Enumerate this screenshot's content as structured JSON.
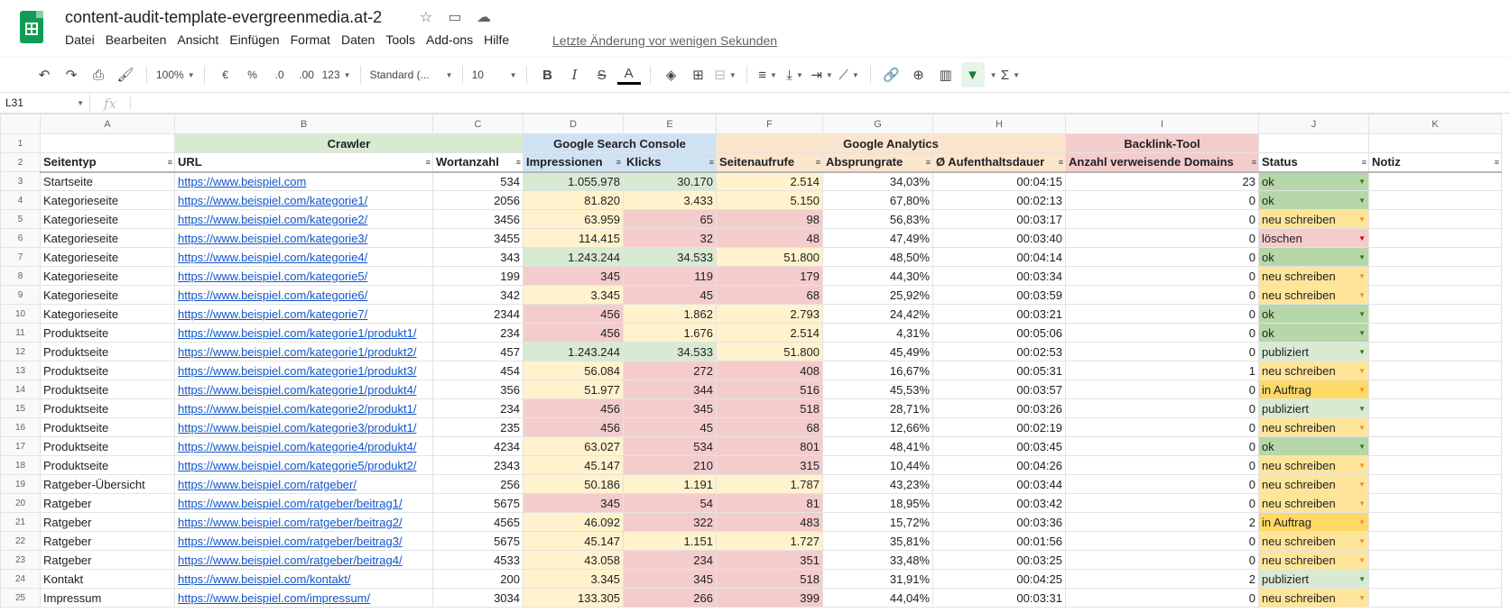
{
  "doc": {
    "title": "content-audit-template-evergreenmedia.at-2",
    "last_edit": "Letzte Änderung vor wenigen Sekunden"
  },
  "menu": [
    "Datei",
    "Bearbeiten",
    "Ansicht",
    "Einfügen",
    "Format",
    "Daten",
    "Tools",
    "Add-ons",
    "Hilfe"
  ],
  "toolbar": {
    "zoom": "100%",
    "currency": "€",
    "percent": "%",
    "dec_less": ".0",
    "dec_more": ".00",
    "more_formats": "123",
    "font": "Standard (...",
    "font_size": "10"
  },
  "formula": {
    "cell_ref": "L31",
    "fx": "fx"
  },
  "columns": [
    "A",
    "B",
    "C",
    "D",
    "E",
    "F",
    "G",
    "H",
    "I",
    "J",
    "K"
  ],
  "groups": {
    "crawler": "Crawler",
    "gsc": "Google Search Console",
    "ga": "Google Analytics",
    "backlink": "Backlink-Tool"
  },
  "headers": [
    "Seitentyp",
    "URL",
    "Wortanzahl",
    "Impressionen",
    "Klicks",
    "Seitenaufrufe",
    "Absprungrate",
    "Ø Aufenthaltsdauer",
    "Anzahl verweisende Domains",
    "Status",
    "Notiz"
  ],
  "colors": {
    "green": "#d9ead3",
    "yellow": "#fff2cc",
    "red": "#f4cccc",
    "link": "#1155cc",
    "brand": "#0f9d58"
  },
  "rows": [
    {
      "n": "3",
      "typ": "Startseite",
      "url": "https://www.beispiel.com",
      "wort": "534",
      "imp": "1.055.978",
      "klick": "30.170",
      "aufr": "2.514",
      "abs": "34,03%",
      "dauer": "00:04:15",
      "dom": "23",
      "status": "ok",
      "ci": "green",
      "ck": "green",
      "ca": "yellow"
    },
    {
      "n": "4",
      "typ": "Kategorieseite",
      "url": "https://www.beispiel.com/kategorie1/",
      "wort": "2056",
      "imp": "81.820",
      "klick": "3.433",
      "aufr": "5.150",
      "abs": "67,80%",
      "dauer": "00:02:13",
      "dom": "0",
      "status": "ok",
      "ci": "yellow",
      "ck": "yellow",
      "ca": "yellow"
    },
    {
      "n": "5",
      "typ": "Kategorieseite",
      "url": "https://www.beispiel.com/kategorie2/",
      "wort": "3456",
      "imp": "63.959",
      "klick": "65",
      "aufr": "98",
      "abs": "56,83%",
      "dauer": "00:03:17",
      "dom": "0",
      "status": "neu schreiben",
      "ci": "yellow",
      "ck": "red",
      "ca": "red"
    },
    {
      "n": "6",
      "typ": "Kategorieseite",
      "url": "https://www.beispiel.com/kategorie3/",
      "wort": "3455",
      "imp": "114.415",
      "klick": "32",
      "aufr": "48",
      "abs": "47,49%",
      "dauer": "00:03:40",
      "dom": "0",
      "status": "löschen",
      "ci": "yellow",
      "ck": "red",
      "ca": "red"
    },
    {
      "n": "7",
      "typ": "Kategorieseite",
      "url": "https://www.beispiel.com/kategorie4/",
      "wort": "343",
      "imp": "1.243.244",
      "klick": "34.533",
      "aufr": "51.800",
      "abs": "48,50%",
      "dauer": "00:04:14",
      "dom": "0",
      "status": "ok",
      "ci": "green",
      "ck": "green",
      "ca": "yellow"
    },
    {
      "n": "8",
      "typ": "Kategorieseite",
      "url": "https://www.beispiel.com/kategorie5/",
      "wort": "199",
      "imp": "345",
      "klick": "119",
      "aufr": "179",
      "abs": "44,30%",
      "dauer": "00:03:34",
      "dom": "0",
      "status": "neu schreiben",
      "ci": "red",
      "ck": "red",
      "ca": "red"
    },
    {
      "n": "9",
      "typ": "Kategorieseite",
      "url": "https://www.beispiel.com/kategorie6/",
      "wort": "342",
      "imp": "3.345",
      "klick": "45",
      "aufr": "68",
      "abs": "25,92%",
      "dauer": "00:03:59",
      "dom": "0",
      "status": "neu schreiben",
      "ci": "yellow",
      "ck": "red",
      "ca": "red"
    },
    {
      "n": "10",
      "typ": "Kategorieseite",
      "url": "https://www.beispiel.com/kategorie7/",
      "wort": "2344",
      "imp": "456",
      "klick": "1.862",
      "aufr": "2.793",
      "abs": "24,42%",
      "dauer": "00:03:21",
      "dom": "0",
      "status": "ok",
      "ci": "red",
      "ck": "yellow",
      "ca": "yellow"
    },
    {
      "n": "11",
      "typ": "Produktseite",
      "url": "https://www.beispiel.com/kategorie1/produkt1/",
      "wort": "234",
      "imp": "456",
      "klick": "1.676",
      "aufr": "2.514",
      "abs": "4,31%",
      "dauer": "00:05:06",
      "dom": "0",
      "status": "ok",
      "ci": "red",
      "ck": "yellow",
      "ca": "yellow"
    },
    {
      "n": "12",
      "typ": "Produktseite",
      "url": "https://www.beispiel.com/kategorie1/produkt2/",
      "wort": "457",
      "imp": "1.243.244",
      "klick": "34.533",
      "aufr": "51.800",
      "abs": "45,49%",
      "dauer": "00:02:53",
      "dom": "0",
      "status": "publiziert",
      "ci": "green",
      "ck": "green",
      "ca": "yellow"
    },
    {
      "n": "13",
      "typ": "Produktseite",
      "url": "https://www.beispiel.com/kategorie1/produkt3/",
      "wort": "454",
      "imp": "56.084",
      "klick": "272",
      "aufr": "408",
      "abs": "16,67%",
      "dauer": "00:05:31",
      "dom": "1",
      "status": "neu schreiben",
      "ci": "yellow",
      "ck": "red",
      "ca": "red"
    },
    {
      "n": "14",
      "typ": "Produktseite",
      "url": "https://www.beispiel.com/kategorie1/produkt4/",
      "wort": "356",
      "imp": "51.977",
      "klick": "344",
      "aufr": "516",
      "abs": "45,53%",
      "dauer": "00:03:57",
      "dom": "0",
      "status": "in Auftrag",
      "ci": "yellow",
      "ck": "red",
      "ca": "red"
    },
    {
      "n": "15",
      "typ": "Produktseite",
      "url": "https://www.beispiel.com/kategorie2/produkt1/",
      "wort": "234",
      "imp": "456",
      "klick": "345",
      "aufr": "518",
      "abs": "28,71%",
      "dauer": "00:03:26",
      "dom": "0",
      "status": "publiziert",
      "ci": "red",
      "ck": "red",
      "ca": "red"
    },
    {
      "n": "16",
      "typ": "Produktseite",
      "url": "https://www.beispiel.com/kategorie3/produkt1/",
      "wort": "235",
      "imp": "456",
      "klick": "45",
      "aufr": "68",
      "abs": "12,66%",
      "dauer": "00:02:19",
      "dom": "0",
      "status": "neu schreiben",
      "ci": "red",
      "ck": "red",
      "ca": "red"
    },
    {
      "n": "17",
      "typ": "Produktseite",
      "url": "https://www.beispiel.com/kategorie4/produkt4/",
      "wort": "4234",
      "imp": "63.027",
      "klick": "534",
      "aufr": "801",
      "abs": "48,41%",
      "dauer": "00:03:45",
      "dom": "0",
      "status": "ok",
      "ci": "yellow",
      "ck": "red",
      "ca": "red"
    },
    {
      "n": "18",
      "typ": "Produktseite",
      "url": "https://www.beispiel.com/kategorie5/produkt2/",
      "wort": "2343",
      "imp": "45.147",
      "klick": "210",
      "aufr": "315",
      "abs": "10,44%",
      "dauer": "00:04:26",
      "dom": "0",
      "status": "neu schreiben",
      "ci": "yellow",
      "ck": "red",
      "ca": "red"
    },
    {
      "n": "19",
      "typ": "Ratgeber-Übersicht",
      "url": "https://www.beispiel.com/ratgeber/",
      "wort": "256",
      "imp": "50.186",
      "klick": "1.191",
      "aufr": "1.787",
      "abs": "43,23%",
      "dauer": "00:03:44",
      "dom": "0",
      "status": "neu schreiben",
      "ci": "yellow",
      "ck": "yellow",
      "ca": "yellow"
    },
    {
      "n": "20",
      "typ": "Ratgeber",
      "url": "https://www.beispiel.com/ratgeber/beitrag1/",
      "wort": "5675",
      "imp": "345",
      "klick": "54",
      "aufr": "81",
      "abs": "18,95%",
      "dauer": "00:03:42",
      "dom": "0",
      "status": "neu schreiben",
      "ci": "red",
      "ck": "red",
      "ca": "red"
    },
    {
      "n": "21",
      "typ": "Ratgeber",
      "url": "https://www.beispiel.com/ratgeber/beitrag2/",
      "wort": "4565",
      "imp": "46.092",
      "klick": "322",
      "aufr": "483",
      "abs": "15,72%",
      "dauer": "00:03:36",
      "dom": "2",
      "status": "in Auftrag",
      "ci": "yellow",
      "ck": "red",
      "ca": "red"
    },
    {
      "n": "22",
      "typ": "Ratgeber",
      "url": "https://www.beispiel.com/ratgeber/beitrag3/",
      "wort": "5675",
      "imp": "45.147",
      "klick": "1.151",
      "aufr": "1.727",
      "abs": "35,81%",
      "dauer": "00:01:56",
      "dom": "0",
      "status": "neu schreiben",
      "ci": "yellow",
      "ck": "yellow",
      "ca": "yellow"
    },
    {
      "n": "23",
      "typ": "Ratgeber",
      "url": "https://www.beispiel.com/ratgeber/beitrag4/",
      "wort": "4533",
      "imp": "43.058",
      "klick": "234",
      "aufr": "351",
      "abs": "33,48%",
      "dauer": "00:03:25",
      "dom": "0",
      "status": "neu schreiben",
      "ci": "yellow",
      "ck": "red",
      "ca": "red"
    },
    {
      "n": "24",
      "typ": "Kontakt",
      "url": "https://www.beispiel.com/kontakt/",
      "wort": "200",
      "imp": "3.345",
      "klick": "345",
      "aufr": "518",
      "abs": "31,91%",
      "dauer": "00:04:25",
      "dom": "2",
      "status": "publiziert",
      "ci": "yellow",
      "ck": "red",
      "ca": "red"
    },
    {
      "n": "25",
      "typ": "Impressum",
      "url": "https://www.beispiel.com/impressum/",
      "wort": "3034",
      "imp": "133.305",
      "klick": "266",
      "aufr": "399",
      "abs": "44,04%",
      "dauer": "00:03:31",
      "dom": "0",
      "status": "neu schreiben",
      "ci": "yellow",
      "ck": "red",
      "ca": "red"
    }
  ]
}
